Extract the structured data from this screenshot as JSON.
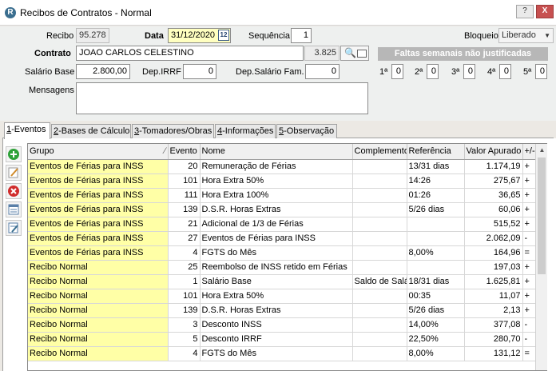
{
  "window": {
    "title": "Recibos de Contratos - Normal",
    "help_label": "?",
    "close_label": "X"
  },
  "form": {
    "recibo_label": "Recibo",
    "recibo_value": "95.278",
    "data_label": "Data",
    "data_value": "31/12/2020",
    "sequencia_label": "Sequência",
    "sequencia_value": "1",
    "bloqueio_label": "Bloqueio",
    "bloqueio_value": "Liberado",
    "contrato_label": "Contrato",
    "contrato_value": "JOAO CARLOS CELESTINO",
    "contrato_code": "3.825",
    "salario_label": "Salário Base",
    "salario_value": "2.800,00",
    "dep_irrf_label": "Dep.IRRF",
    "dep_irrf_value": "0",
    "dep_sal_label": "Dep.Salário Fam.",
    "dep_sal_value": "0",
    "mensagens_label": "Mensagens",
    "mensagens_value": "",
    "faltas_title": "Faltas semanais não justificadas",
    "faltas": [
      {
        "label": "1ª",
        "value": "0"
      },
      {
        "label": "2ª",
        "value": "0"
      },
      {
        "label": "3ª",
        "value": "0"
      },
      {
        "label": "4ª",
        "value": "0"
      },
      {
        "label": "5ª",
        "value": "0"
      }
    ]
  },
  "tabs": [
    {
      "key": "1",
      "rest": "-Eventos"
    },
    {
      "key": "2",
      "rest": "-Bases de Cálculo"
    },
    {
      "key": "3",
      "rest": "-Tomadores/Obras"
    },
    {
      "key": "4",
      "rest": "-Informações"
    },
    {
      "key": "5",
      "rest": "-Observação"
    }
  ],
  "table": {
    "columns": [
      "Grupo",
      "Evento",
      "Nome",
      "Complemento",
      "Referência",
      "Valor Apurado",
      "+/-"
    ],
    "rows": [
      [
        "Eventos de Férias para INSS",
        "20",
        "Remuneração de Férias",
        "",
        "13/31 dias",
        "1.174,19",
        "+"
      ],
      [
        "Eventos de Férias para INSS",
        "101",
        "Hora Extra 50%",
        "",
        "14:26",
        "275,67",
        "+"
      ],
      [
        "Eventos de Férias para INSS",
        "111",
        "Hora Extra 100%",
        "",
        "01:26",
        "36,65",
        "+"
      ],
      [
        "Eventos de Férias para INSS",
        "139",
        "D.S.R. Horas Extras",
        "",
        "5/26 dias",
        "60,06",
        "+"
      ],
      [
        "Eventos de Férias para INSS",
        "21",
        "Adicional de 1/3 de Férias",
        "",
        "",
        "515,52",
        "+"
      ],
      [
        "Eventos de Férias para INSS",
        "27",
        "Eventos de Férias para INSS",
        "",
        "",
        "2.062,09",
        "-"
      ],
      [
        "Eventos de Férias para INSS",
        "4",
        "FGTS do Mês",
        "",
        "8,00%",
        "164,96",
        "="
      ],
      [
        "Recibo Normal",
        "25",
        "Reembolso de INSS retido em Férias",
        "",
        "",
        "197,03",
        "+"
      ],
      [
        "Recibo Normal",
        "1",
        "Salário Base",
        "Saldo de Salário",
        "18/31 dias",
        "1.625,81",
        "+"
      ],
      [
        "Recibo Normal",
        "101",
        "Hora Extra 50%",
        "",
        "00:35",
        "11,07",
        "+"
      ],
      [
        "Recibo Normal",
        "139",
        "D.S.R. Horas Extras",
        "",
        "5/26 dias",
        "2,13",
        "+"
      ],
      [
        "Recibo Normal",
        "3",
        "Desconto INSS",
        "",
        "14,00%",
        "377,08",
        "-"
      ],
      [
        "Recibo Normal",
        "5",
        "Desconto IRRF",
        "",
        "22,50%",
        "280,70",
        "-"
      ],
      [
        "Recibo Normal",
        "4",
        "FGTS do Mês",
        "",
        "8,00%",
        "131,12",
        "="
      ]
    ]
  },
  "toolbar": [
    "add-icon",
    "edit-icon",
    "delete-icon",
    "list-icon",
    "notes-icon"
  ]
}
